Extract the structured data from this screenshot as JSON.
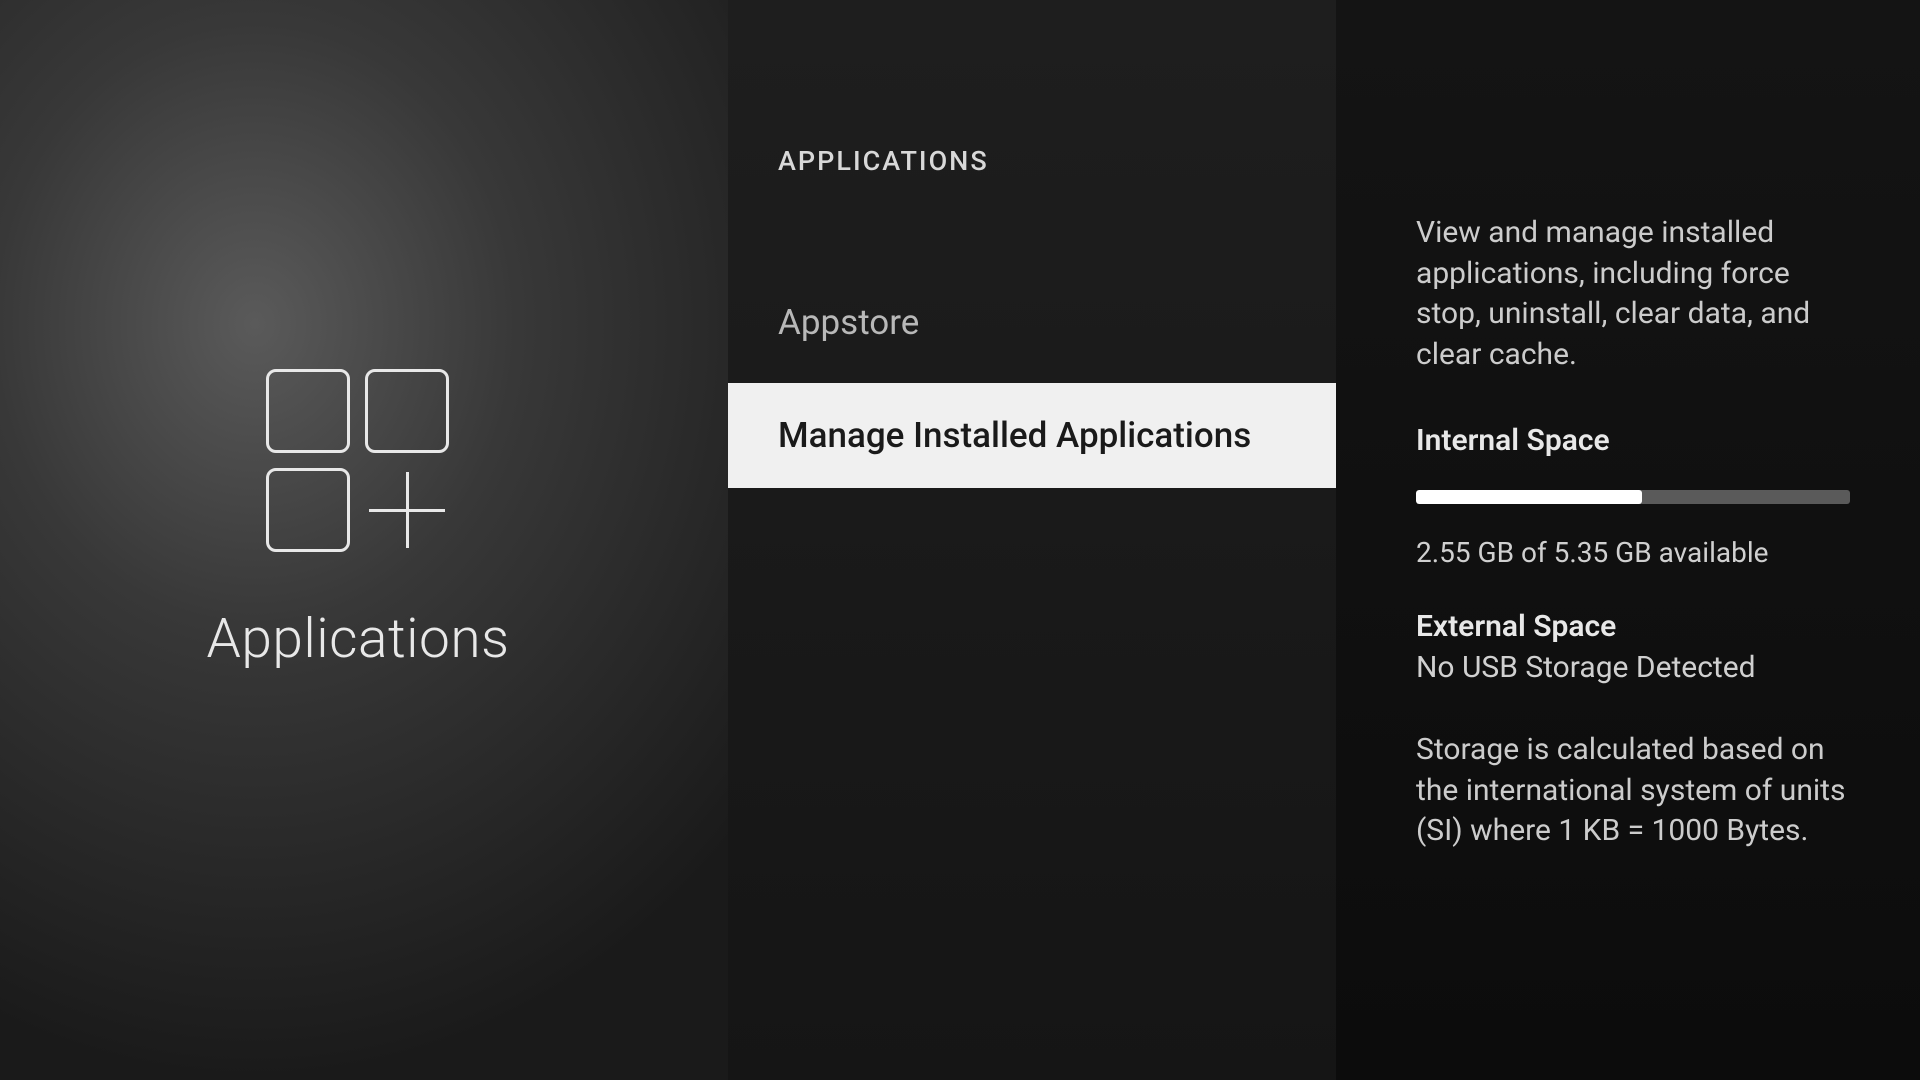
{
  "left": {
    "title": "Applications",
    "icon_name": "applications-grid-icon"
  },
  "middle": {
    "header": "APPLICATIONS",
    "items": [
      {
        "label": "Appstore",
        "selected": false
      },
      {
        "label": "Manage Installed Applications",
        "selected": true
      }
    ]
  },
  "right": {
    "description": "View and manage installed applications, including force stop, uninstall, clear data, and clear cache.",
    "internal": {
      "heading": "Internal Space",
      "used_gb": 2.55,
      "total_gb": 5.35,
      "text": "2.55 GB of 5.35 GB available",
      "fill_percent": 52
    },
    "external": {
      "heading": "External Space",
      "status": "No USB Storage Detected"
    },
    "footnote": "Storage is calculated based on the international system of units (SI) where 1 KB = 1000 Bytes."
  }
}
